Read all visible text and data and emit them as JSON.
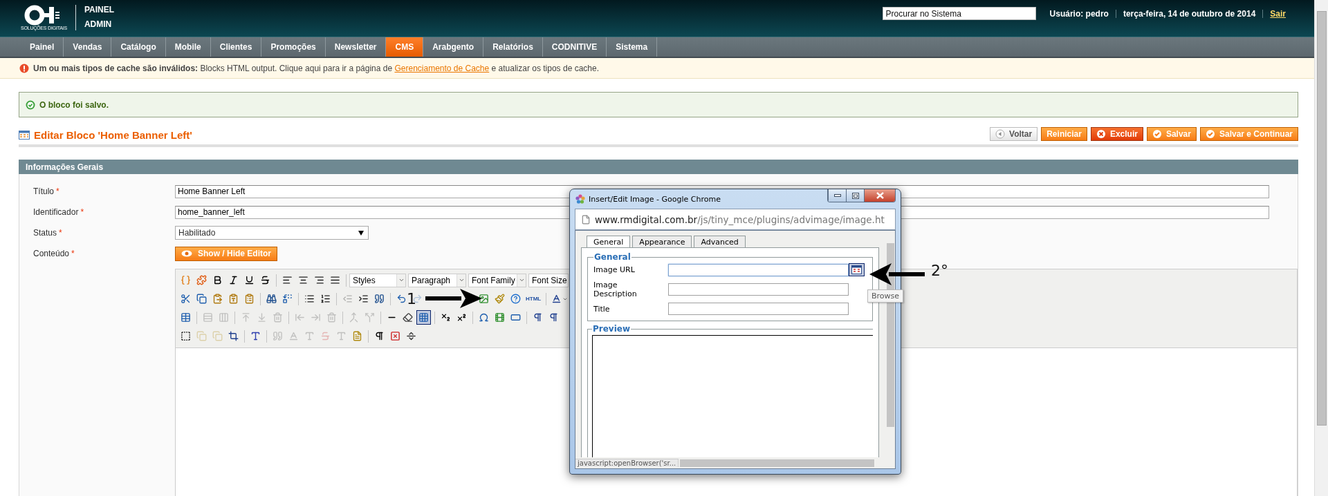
{
  "header": {
    "logo_caption": "SOLUÇÕES DIGITAIS",
    "brand": [
      "PAINEL",
      "ADMIN"
    ],
    "search": {
      "placeholder": "Procurar no Sistema"
    },
    "user": "Usuário: pedro",
    "date": "terça-feira, 14 de outubro de 2014",
    "logout": "Sair"
  },
  "nav": [
    {
      "label": "Painel",
      "selected": false
    },
    {
      "label": "Vendas",
      "selected": false
    },
    {
      "label": "Catálogo",
      "selected": false
    },
    {
      "label": "Mobile",
      "selected": false
    },
    {
      "label": "Clientes",
      "selected": false
    },
    {
      "label": "Promoções",
      "selected": false
    },
    {
      "label": "Newsletter",
      "selected": false
    },
    {
      "label": "CMS",
      "selected": true
    },
    {
      "label": "Arabgento",
      "selected": false
    },
    {
      "label": "Relatórios",
      "selected": false
    },
    {
      "label": "CODNITIVE",
      "selected": false
    },
    {
      "label": "Sistema",
      "selected": false
    }
  ],
  "notice": {
    "text": "**Um ou mais tipos de cache são inválidos:** Blocks HTML output. Clique aqui para ir a página de",
    "link": "Gerenciamento de Cache",
    "text_after": "e atualizar os tipos de cache."
  },
  "success_message": "O bloco foi salvo.",
  "page_title": "Editar Bloco 'Home Banner Left'",
  "actions": [
    {
      "label": "Voltar",
      "kind": "back"
    },
    {
      "label": "Reiniciar",
      "kind": "reset"
    },
    {
      "label": "Excluir",
      "kind": "delete"
    },
    {
      "label": "Salvar",
      "kind": "save"
    },
    {
      "label": "Salvar e Continuar",
      "kind": "save"
    }
  ],
  "section": {
    "title": "Informações Gerais",
    "fields": [
      {
        "label": "Título",
        "marker": "*",
        "kind": "text",
        "value": "Home Banner Left"
      },
      {
        "label": "Identificador",
        "marker": "*",
        "kind": "text",
        "value": "home_banner_left"
      },
      {
        "label": "Status",
        "marker": "*",
        "kind": "select",
        "value": "Habilitado"
      },
      {
        "label": "Conteúdo",
        "marker": "*",
        "kind": "button",
        "value": "Show / Hide Editor"
      }
    ]
  },
  "editor": {
    "toolbar": [
      [
        {
          "kind": "button",
          "disabled": false,
          "active": false
        },
        {
          "kind": "button",
          "disabled": false,
          "active": false
        },
        {
          "kind": "button",
          "disabled": false,
          "active": false
        },
        {
          "kind": "button",
          "disabled": false,
          "active": false
        },
        {
          "kind": "button",
          "disabled": false,
          "active": false
        },
        {
          "kind": "button",
          "disabled": false,
          "active": false
        },
        {
          "kind": "separator"
        },
        {
          "kind": "button",
          "disabled": false,
          "active": false
        },
        {
          "kind": "button",
          "disabled": false,
          "active": false
        },
        {
          "kind": "button",
          "disabled": false,
          "active": false
        },
        {
          "kind": "button",
          "disabled": false,
          "active": false
        },
        {
          "kind": "separator"
        },
        {
          "kind": "select",
          "label": "Styles"
        },
        {
          "kind": "select",
          "label": "Paragraph"
        },
        {
          "kind": "select",
          "label": "Font Family"
        },
        {
          "kind": "select",
          "label": "Font Size"
        }
      ],
      [
        {
          "kind": "button",
          "disabled": false,
          "active": false
        },
        {
          "kind": "button",
          "disabled": false,
          "active": false
        },
        {
          "kind": "button",
          "disabled": false,
          "active": false
        },
        {
          "kind": "button",
          "disabled": false,
          "active": false
        },
        {
          "kind": "button",
          "disabled": false,
          "active": false
        },
        {
          "kind": "separator"
        },
        {
          "kind": "button",
          "disabled": false,
          "active": false
        },
        {
          "kind": "button",
          "disabled": false,
          "active": false
        },
        {
          "kind": "separator"
        },
        {
          "kind": "button",
          "disabled": false,
          "active": false
        },
        {
          "kind": "button",
          "disabled": false,
          "active": false
        },
        {
          "kind": "separator"
        },
        {
          "kind": "button",
          "disabled": true,
          "active": false
        },
        {
          "kind": "button",
          "disabled": false,
          "active": false
        },
        {
          "kind": "button",
          "disabled": false,
          "active": false
        },
        {
          "kind": "separator"
        },
        {
          "kind": "button",
          "disabled": false,
          "active": false
        },
        {
          "kind": "button",
          "disabled": true,
          "active": false
        },
        {
          "kind": "button",
          "disabled": false,
          "active": false
        },
        {
          "kind": "button",
          "disabled": false,
          "active": false
        },
        {
          "kind": "button",
          "disabled": false,
          "active": false
        },
        {
          "kind": "button",
          "disabled": false,
          "active": false,
          "label": "HTML"
        },
        {
          "kind": "separator"
        },
        {
          "kind": "button",
          "disabled": false,
          "active": false
        }
      ],
      [
        {
          "kind": "button",
          "disabled": false,
          "active": false
        },
        {
          "kind": "separator"
        },
        {
          "kind": "button",
          "disabled": true,
          "active": false
        },
        {
          "kind": "button",
          "disabled": true,
          "active": false
        },
        {
          "kind": "separator"
        },
        {
          "kind": "button",
          "disabled": true,
          "active": false
        },
        {
          "kind": "button",
          "disabled": true,
          "active": false
        },
        {
          "kind": "button",
          "disabled": true,
          "active": false
        },
        {
          "kind": "separator"
        },
        {
          "kind": "button",
          "disabled": true,
          "active": false
        },
        {
          "kind": "button",
          "disabled": true,
          "active": false
        },
        {
          "kind": "button",
          "disabled": true,
          "active": false
        },
        {
          "kind": "separator"
        },
        {
          "kind": "button",
          "disabled": true,
          "active": false
        },
        {
          "kind": "button",
          "disabled": true,
          "active": false
        },
        {
          "kind": "separator"
        },
        {
          "kind": "button",
          "disabled": false,
          "active": false
        },
        {
          "kind": "button",
          "disabled": false,
          "active": false
        },
        {
          "kind": "button",
          "disabled": false,
          "active": true
        },
        {
          "kind": "separator"
        },
        {
          "kind": "button",
          "disabled": false,
          "active": false
        },
        {
          "kind": "button",
          "disabled": false,
          "active": false
        },
        {
          "kind": "separator"
        },
        {
          "kind": "button",
          "disabled": false,
          "active": false
        },
        {
          "kind": "button",
          "disabled": false,
          "active": false
        },
        {
          "kind": "button",
          "disabled": false,
          "active": false
        },
        {
          "kind": "separator"
        },
        {
          "kind": "button",
          "disabled": false,
          "active": false
        },
        {
          "kind": "button",
          "disabled": false,
          "active": false
        }
      ],
      [
        {
          "kind": "button",
          "disabled": false,
          "active": false
        },
        {
          "kind": "button",
          "disabled": true,
          "active": false
        },
        {
          "kind": "button",
          "disabled": true,
          "active": false
        },
        {
          "kind": "button",
          "disabled": false,
          "active": false
        },
        {
          "kind": "separator"
        },
        {
          "kind": "button",
          "disabled": false,
          "active": false
        },
        {
          "kind": "separator"
        },
        {
          "kind": "button",
          "disabled": true,
          "active": false
        },
        {
          "kind": "button",
          "disabled": true,
          "active": false
        },
        {
          "kind": "button",
          "disabled": true,
          "active": false
        },
        {
          "kind": "button",
          "disabled": true,
          "active": false
        },
        {
          "kind": "button",
          "disabled": true,
          "active": false
        },
        {
          "kind": "button",
          "disabled": false,
          "active": false
        },
        {
          "kind": "separator"
        },
        {
          "kind": "button",
          "disabled": false,
          "active": false
        },
        {
          "kind": "button",
          "disabled": false,
          "active": false
        },
        {
          "kind": "button",
          "disabled": false,
          "active": false
        }
      ]
    ]
  },
  "dialog": {
    "title": "Insert/Edit Image - Google Chrome",
    "address": {
      "host": "www.rmdigital.com.br",
      "path": "/js/tiny_mce/plugins/advimage/image.ht"
    },
    "tabs": [
      {
        "label": "General",
        "selected": true
      },
      {
        "label": "Appearance",
        "selected": false
      },
      {
        "label": "Advanced",
        "selected": false
      }
    ],
    "legend": "General",
    "fields": [
      {
        "label": "Image URL",
        "kind": "browse",
        "focused": true
      },
      {
        "label": "Image Description",
        "kind": "text",
        "focused": false
      },
      {
        "label": "Title",
        "kind": "text",
        "focused": false
      }
    ],
    "tooltip": "Browse",
    "preview_legend": "Preview",
    "status": "javascript:openBrowser('sr..."
  },
  "annotations": [
    {
      "text": "1"
    },
    {
      "text": "2°"
    }
  ]
}
